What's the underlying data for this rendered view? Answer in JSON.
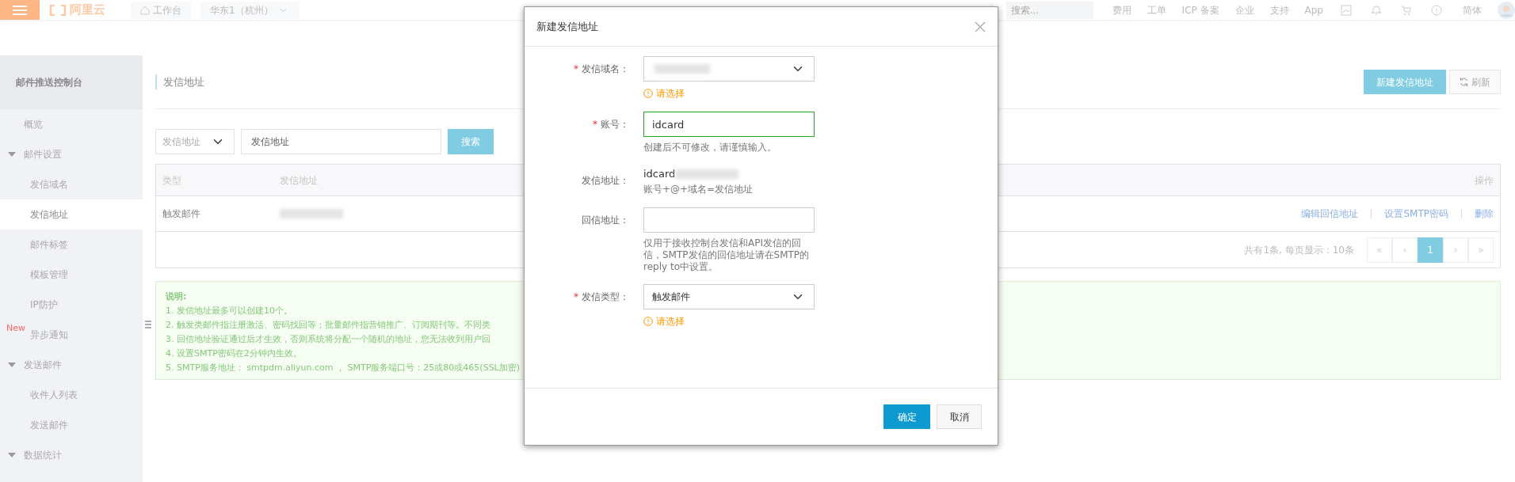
{
  "top_bar": {
    "logo": "阿里云",
    "workbench": "工作台",
    "region": "华东1（杭州）",
    "search": {
      "placeholder": "搜索..."
    },
    "links": [
      "费用",
      "工单",
      "ICP 备案",
      "企业",
      "支持",
      "App"
    ],
    "language": "简体"
  },
  "sidebar": {
    "title": "邮件推送控制台",
    "items": [
      {
        "label": "概览",
        "selected": false
      },
      {
        "label": "邮件设置",
        "expanded": true,
        "children": [
          {
            "label": "发信域名",
            "selected": false
          },
          {
            "label": "发信地址",
            "selected": true
          },
          {
            "label": "邮件标签",
            "selected": false
          },
          {
            "label": "模板管理",
            "selected": false
          },
          {
            "label": "IP防护",
            "selected": false
          },
          {
            "label": "异步通知",
            "selected": false,
            "badge": "New"
          }
        ]
      },
      {
        "label": "发送邮件",
        "expanded": true,
        "children": [
          {
            "label": "收件人列表",
            "selected": false
          },
          {
            "label": "发送邮件",
            "selected": false
          }
        ]
      },
      {
        "label": "数据统计",
        "expanded": true
      }
    ]
  },
  "page": {
    "title": "发信地址",
    "create_button": "新建发信地址",
    "refresh_button": "刷新"
  },
  "filter": {
    "field": "发信地址",
    "search": {
      "placeholder": "发信地址"
    },
    "button": "搜索"
  },
  "table": {
    "columns": [
      "类型",
      "发信地址",
      "操作"
    ],
    "rows": [
      {
        "type": "触发邮件",
        "address_redacted": true,
        "actions": [
          "编辑回信地址",
          "设置SMTP密码",
          "删除"
        ]
      }
    ]
  },
  "pagination": {
    "summary": "共有1条, 每页显示：10条",
    "pages": [
      {
        "label": "«",
        "selected": false
      },
      {
        "label": "‹",
        "selected": false
      },
      {
        "label": "1",
        "selected": true
      },
      {
        "label": "›",
        "selected": false
      },
      {
        "label": "»",
        "selected": false
      }
    ]
  },
  "notes": {
    "title": "说明:",
    "lines": [
      "1. 发信地址最多可以创建10个。",
      "2. 触发类邮件指注册激活、密码找回等；批量邮件指营销推广、订阅期刊等。不同类",
      "3. 回信地址验证通过后才生效，否则系统将分配一个随机的地址，您无法收到用户回",
      "4. 设置SMTP密码在2分钟内生效。",
      "5. SMTP服务地址： smtpdm.aliyun.com ， SMTP服务端口号：25或80或465(SSL加密)"
    ]
  },
  "dialog": {
    "title": "新建发信地址",
    "fields": [
      {
        "kind": "select",
        "required": true,
        "marker": "*",
        "label": "发信域名：",
        "redacted": true,
        "warning": "请选择"
      },
      {
        "kind": "input",
        "required": true,
        "marker": "*",
        "label": "账号：",
        "value": "idcard",
        "valid": true,
        "hint": "创建后不可修改，请谨慎输入。"
      },
      {
        "kind": "text",
        "required": false,
        "label": "发信地址：",
        "value": "idcard",
        "redacted": true,
        "hint": "账号+@+域名=发信地址"
      },
      {
        "kind": "input",
        "required": false,
        "label": "回信地址：",
        "valid": false,
        "hint": "仅用于接收控制台发信和API发信的回信，SMTP发信的回信地址请在SMTP的reply to中设置。"
      },
      {
        "kind": "select",
        "required": true,
        "marker": "*",
        "label": "发信类型：",
        "value": "触发邮件",
        "warning": "请选择"
      }
    ],
    "ok_button": "确定",
    "cancel_button": "取消"
  }
}
